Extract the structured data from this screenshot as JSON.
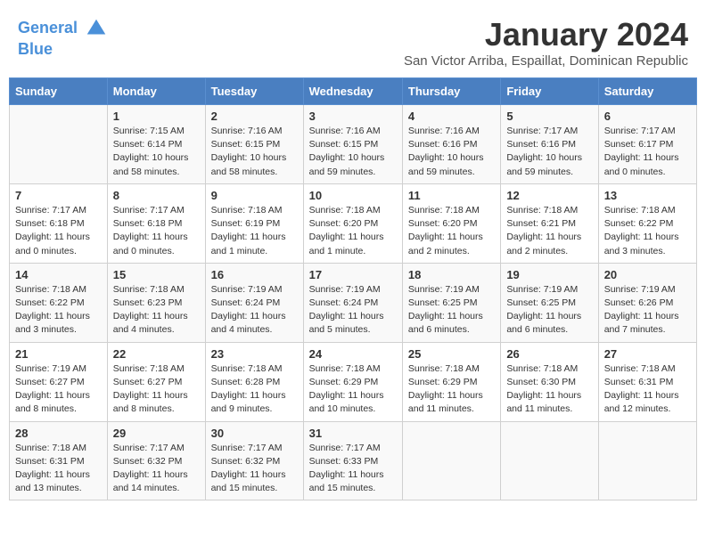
{
  "header": {
    "logo_line1": "General",
    "logo_line2": "Blue",
    "month_title": "January 2024",
    "location": "San Victor Arriba, Espaillat, Dominican Republic"
  },
  "days_of_week": [
    "Sunday",
    "Monday",
    "Tuesday",
    "Wednesday",
    "Thursday",
    "Friday",
    "Saturday"
  ],
  "weeks": [
    [
      {
        "num": "",
        "info": ""
      },
      {
        "num": "1",
        "info": "Sunrise: 7:15 AM\nSunset: 6:14 PM\nDaylight: 10 hours\nand 58 minutes."
      },
      {
        "num": "2",
        "info": "Sunrise: 7:16 AM\nSunset: 6:15 PM\nDaylight: 10 hours\nand 58 minutes."
      },
      {
        "num": "3",
        "info": "Sunrise: 7:16 AM\nSunset: 6:15 PM\nDaylight: 10 hours\nand 59 minutes."
      },
      {
        "num": "4",
        "info": "Sunrise: 7:16 AM\nSunset: 6:16 PM\nDaylight: 10 hours\nand 59 minutes."
      },
      {
        "num": "5",
        "info": "Sunrise: 7:17 AM\nSunset: 6:16 PM\nDaylight: 10 hours\nand 59 minutes."
      },
      {
        "num": "6",
        "info": "Sunrise: 7:17 AM\nSunset: 6:17 PM\nDaylight: 11 hours\nand 0 minutes."
      }
    ],
    [
      {
        "num": "7",
        "info": "Sunrise: 7:17 AM\nSunset: 6:18 PM\nDaylight: 11 hours\nand 0 minutes."
      },
      {
        "num": "8",
        "info": "Sunrise: 7:17 AM\nSunset: 6:18 PM\nDaylight: 11 hours\nand 0 minutes."
      },
      {
        "num": "9",
        "info": "Sunrise: 7:18 AM\nSunset: 6:19 PM\nDaylight: 11 hours\nand 1 minute."
      },
      {
        "num": "10",
        "info": "Sunrise: 7:18 AM\nSunset: 6:20 PM\nDaylight: 11 hours\nand 1 minute."
      },
      {
        "num": "11",
        "info": "Sunrise: 7:18 AM\nSunset: 6:20 PM\nDaylight: 11 hours\nand 2 minutes."
      },
      {
        "num": "12",
        "info": "Sunrise: 7:18 AM\nSunset: 6:21 PM\nDaylight: 11 hours\nand 2 minutes."
      },
      {
        "num": "13",
        "info": "Sunrise: 7:18 AM\nSunset: 6:22 PM\nDaylight: 11 hours\nand 3 minutes."
      }
    ],
    [
      {
        "num": "14",
        "info": "Sunrise: 7:18 AM\nSunset: 6:22 PM\nDaylight: 11 hours\nand 3 minutes."
      },
      {
        "num": "15",
        "info": "Sunrise: 7:18 AM\nSunset: 6:23 PM\nDaylight: 11 hours\nand 4 minutes."
      },
      {
        "num": "16",
        "info": "Sunrise: 7:19 AM\nSunset: 6:24 PM\nDaylight: 11 hours\nand 4 minutes."
      },
      {
        "num": "17",
        "info": "Sunrise: 7:19 AM\nSunset: 6:24 PM\nDaylight: 11 hours\nand 5 minutes."
      },
      {
        "num": "18",
        "info": "Sunrise: 7:19 AM\nSunset: 6:25 PM\nDaylight: 11 hours\nand 6 minutes."
      },
      {
        "num": "19",
        "info": "Sunrise: 7:19 AM\nSunset: 6:25 PM\nDaylight: 11 hours\nand 6 minutes."
      },
      {
        "num": "20",
        "info": "Sunrise: 7:19 AM\nSunset: 6:26 PM\nDaylight: 11 hours\nand 7 minutes."
      }
    ],
    [
      {
        "num": "21",
        "info": "Sunrise: 7:19 AM\nSunset: 6:27 PM\nDaylight: 11 hours\nand 8 minutes."
      },
      {
        "num": "22",
        "info": "Sunrise: 7:18 AM\nSunset: 6:27 PM\nDaylight: 11 hours\nand 8 minutes."
      },
      {
        "num": "23",
        "info": "Sunrise: 7:18 AM\nSunset: 6:28 PM\nDaylight: 11 hours\nand 9 minutes."
      },
      {
        "num": "24",
        "info": "Sunrise: 7:18 AM\nSunset: 6:29 PM\nDaylight: 11 hours\nand 10 minutes."
      },
      {
        "num": "25",
        "info": "Sunrise: 7:18 AM\nSunset: 6:29 PM\nDaylight: 11 hours\nand 11 minutes."
      },
      {
        "num": "26",
        "info": "Sunrise: 7:18 AM\nSunset: 6:30 PM\nDaylight: 11 hours\nand 11 minutes."
      },
      {
        "num": "27",
        "info": "Sunrise: 7:18 AM\nSunset: 6:31 PM\nDaylight: 11 hours\nand 12 minutes."
      }
    ],
    [
      {
        "num": "28",
        "info": "Sunrise: 7:18 AM\nSunset: 6:31 PM\nDaylight: 11 hours\nand 13 minutes."
      },
      {
        "num": "29",
        "info": "Sunrise: 7:17 AM\nSunset: 6:32 PM\nDaylight: 11 hours\nand 14 minutes."
      },
      {
        "num": "30",
        "info": "Sunrise: 7:17 AM\nSunset: 6:32 PM\nDaylight: 11 hours\nand 15 minutes."
      },
      {
        "num": "31",
        "info": "Sunrise: 7:17 AM\nSunset: 6:33 PM\nDaylight: 11 hours\nand 15 minutes."
      },
      {
        "num": "",
        "info": ""
      },
      {
        "num": "",
        "info": ""
      },
      {
        "num": "",
        "info": ""
      }
    ]
  ]
}
